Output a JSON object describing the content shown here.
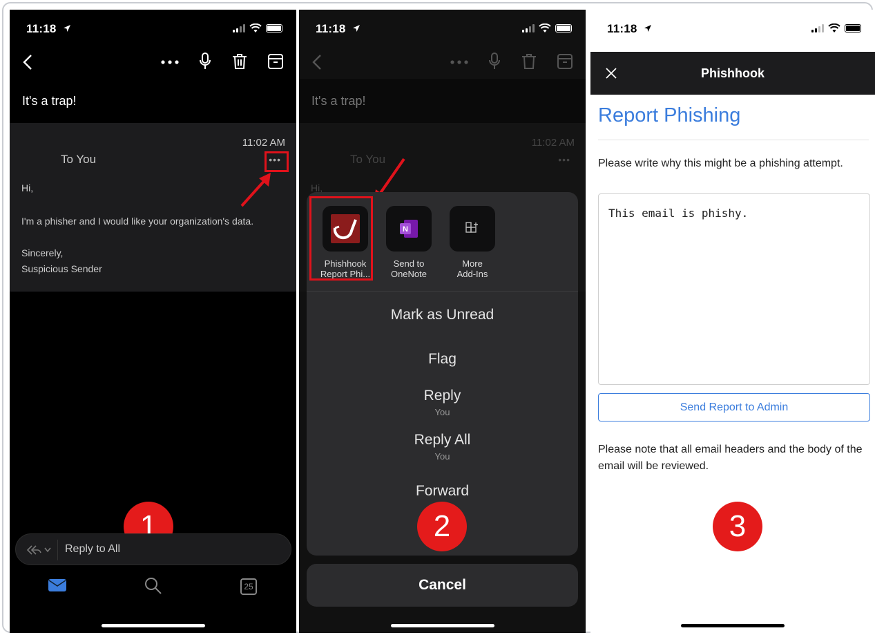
{
  "panel1": {
    "status_time": "11:18",
    "email_subject": "It's a trap!",
    "message": {
      "time": "11:02 AM",
      "to": "To You",
      "greeting": "Hi,",
      "body": "I'm a phisher and I would like your organization's data.",
      "signoff": "Sincerely,",
      "sender": "Suspicious Sender"
    },
    "reply_bar_label": "Reply to All",
    "calendar_date": "25",
    "step_number": "1"
  },
  "panel2": {
    "status_time": "11:18",
    "email_subject": "It's a trap!",
    "message_time": "11:02 AM",
    "message_to": "To You",
    "greeting": "Hi,",
    "addins": [
      {
        "label_line1": "Phishhook",
        "label_line2": "Report Phi..."
      },
      {
        "label_line1": "Send to",
        "label_line2": "OneNote"
      },
      {
        "label_line1": "More",
        "label_line2": "Add-Ins"
      }
    ],
    "actions": {
      "mark_unread": "Mark as Unread",
      "flag": "Flag",
      "reply": "Reply",
      "reply_sub": "You",
      "reply_all": "Reply All",
      "reply_all_sub": "You",
      "forward": "Forward"
    },
    "cancel_label": "Cancel",
    "step_number": "2"
  },
  "panel3": {
    "status_time": "11:18",
    "header_title": "Phishhook",
    "report_title": "Report Phishing",
    "prompt": "Please write why this might be a phishing attempt.",
    "textarea_value": "This email is phishy.",
    "send_button": "Send Report to Admin",
    "note": "Please note that all email headers and the body of the email will be reviewed.",
    "step_number": "3"
  },
  "colors": {
    "accent_blue": "#3b7ddd",
    "highlight_red": "#e0121b",
    "badge_red": "#e41b1b"
  }
}
